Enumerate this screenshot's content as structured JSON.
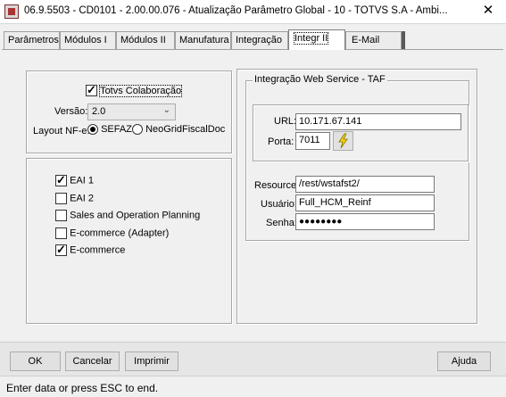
{
  "window": {
    "title": "06.9.5503 - CD0101 - 2.00.00.076 - Atualização Parâmetro Global - 10 - TOTVS S.A - Ambi...",
    "close_glyph": "✕",
    "app_icon": "app-icon"
  },
  "tabs": [
    {
      "label": "Parâmetros",
      "active": false
    },
    {
      "label": "Módulos I",
      "active": false
    },
    {
      "label": "Módulos II",
      "active": false
    },
    {
      "label": "Manufatura",
      "active": false
    },
    {
      "label": "Integração",
      "active": false
    },
    {
      "label": "Integr II",
      "active": true
    },
    {
      "label": "E-Mail",
      "active": false
    }
  ],
  "colaboracao": {
    "checkbox_label": "Totvs Colaboração",
    "checked": true,
    "versao_label": "Versão:",
    "versao_value": "2.0",
    "layout_label": "Layout NF-e:",
    "options": [
      {
        "label": "SEFAZ",
        "selected": true
      },
      {
        "label": "NeoGridFiscalDoc",
        "selected": false
      }
    ]
  },
  "eai": {
    "items": [
      {
        "label": "EAI 1",
        "checked": true
      },
      {
        "label": "EAI 2",
        "checked": false
      },
      {
        "label": "Sales and Operation Planning",
        "checked": false
      },
      {
        "label": "E-commerce (Adapter)",
        "checked": false
      },
      {
        "label": "E-commerce",
        "checked": true
      }
    ]
  },
  "taf": {
    "title": "Integração Web Service - TAF",
    "url_label": "URL:",
    "url_value": "10.171.67.141",
    "porta_label": "Porta:",
    "porta_value": "7011",
    "test_icon": "lightning-icon",
    "resource_label": "Resource:",
    "resource_value": "/rest/wstafst2/",
    "usuario_label": "Usuário:",
    "usuario_value": "Full_HCM_Reinf",
    "senha_label": "Senha:",
    "senha_value": "●●●●●●●●"
  },
  "buttons": {
    "ok": "OK",
    "cancelar": "Cancelar",
    "imprimir": "Imprimir",
    "ajuda": "Ajuda"
  },
  "status": {
    "text": "Enter data or press ESC to end."
  }
}
